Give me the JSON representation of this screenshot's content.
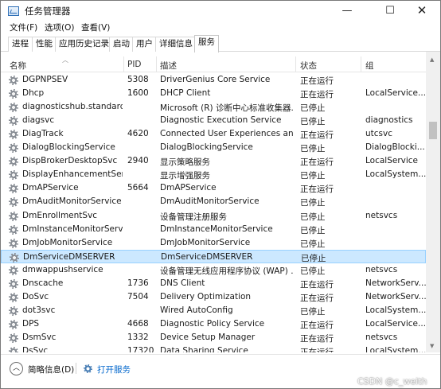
{
  "window": {
    "title": "任务管理器",
    "controls": {
      "minimize": "—",
      "maximize": "☐",
      "close": "✕"
    }
  },
  "menu": [
    "文件(F)",
    "选项(O)",
    "查看(V)"
  ],
  "tabs": [
    "进程",
    "性能",
    "应用历史记录",
    "启动",
    "用户",
    "详细信息",
    "服务"
  ],
  "active_tab": "服务",
  "columns": {
    "name": "名称",
    "pid": "PID",
    "desc": "描述",
    "status": "状态",
    "group": "组"
  },
  "rows": [
    {
      "name": "DGPNPSEV",
      "pid": "5308",
      "desc": "DriverGenius Core Service",
      "status": "正在运行",
      "group": ""
    },
    {
      "name": "Dhcp",
      "pid": "1600",
      "desc": "DHCP Client",
      "status": "正在运行",
      "group": "LocalService..."
    },
    {
      "name": "diagnosticshub.standard...",
      "pid": "",
      "desc": "Microsoft (R) 诊断中心标准收集器...",
      "status": "已停止",
      "group": ""
    },
    {
      "name": "diagsvc",
      "pid": "",
      "desc": "Diagnostic Execution Service",
      "status": "已停止",
      "group": "diagnostics"
    },
    {
      "name": "DiagTrack",
      "pid": "4620",
      "desc": "Connected User Experiences and...",
      "status": "正在运行",
      "group": "utcsvc"
    },
    {
      "name": "DialogBlockingService",
      "pid": "",
      "desc": "DialogBlockingService",
      "status": "已停止",
      "group": "DialogBlocki..."
    },
    {
      "name": "DispBrokerDesktopSvc",
      "pid": "2940",
      "desc": "显示策略服务",
      "status": "正在运行",
      "group": "LocalService"
    },
    {
      "name": "DisplayEnhancementServ...",
      "pid": "",
      "desc": "显示增强服务",
      "status": "已停止",
      "group": "LocalSystem..."
    },
    {
      "name": "DmAPService",
      "pid": "5664",
      "desc": "DmAPService",
      "status": "正在运行",
      "group": ""
    },
    {
      "name": "DmAuditMonitorService",
      "pid": "",
      "desc": "DmAuditMonitorService",
      "status": "已停止",
      "group": ""
    },
    {
      "name": "DmEnrollmentSvc",
      "pid": "",
      "desc": "设备管理注册服务",
      "status": "已停止",
      "group": "netsvcs"
    },
    {
      "name": "DmInstanceMonitorServi...",
      "pid": "",
      "desc": "DmInstanceMonitorService",
      "status": "已停止",
      "group": ""
    },
    {
      "name": "DmJobMonitorService",
      "pid": "",
      "desc": "DmJobMonitorService",
      "status": "已停止",
      "group": ""
    },
    {
      "name": "DmServiceDMSERVER",
      "pid": "",
      "desc": "DmServiceDMSERVER",
      "status": "已停止",
      "group": ""
    },
    {
      "name": "dmwappushservice",
      "pid": "",
      "desc": "设备管理无线应用程序协议 (WAP) ...",
      "status": "已停止",
      "group": "netsvcs"
    },
    {
      "name": "Dnscache",
      "pid": "1736",
      "desc": "DNS Client",
      "status": "正在运行",
      "group": "NetworkServ..."
    },
    {
      "name": "DoSvc",
      "pid": "7504",
      "desc": "Delivery Optimization",
      "status": "正在运行",
      "group": "NetworkServ..."
    },
    {
      "name": "dot3svc",
      "pid": "",
      "desc": "Wired AutoConfig",
      "status": "已停止",
      "group": "LocalSystem..."
    },
    {
      "name": "DPS",
      "pid": "4668",
      "desc": "Diagnostic Policy Service",
      "status": "正在运行",
      "group": "LocalService..."
    },
    {
      "name": "DsmSvc",
      "pid": "1332",
      "desc": "Device Setup Manager",
      "status": "正在运行",
      "group": "netsvcs"
    },
    {
      "name": "DsSvc",
      "pid": "17320",
      "desc": "Data Sharing Service",
      "status": "正在运行",
      "group": "LocalSystem..."
    }
  ],
  "selected_row_name": "DmServiceDMSERVER",
  "footer": {
    "fewer_details": "简略信息(D)",
    "open_services": "打开服务"
  },
  "watermark": "CSDN @c_weith",
  "icons": {
    "app": "task-manager-icon",
    "service": "gear-icon",
    "collapse": "chevron-up-icon"
  },
  "colors": {
    "selected_bg": "#cce8ff",
    "selected_border": "#99d1ff",
    "link": "#0066cc"
  }
}
